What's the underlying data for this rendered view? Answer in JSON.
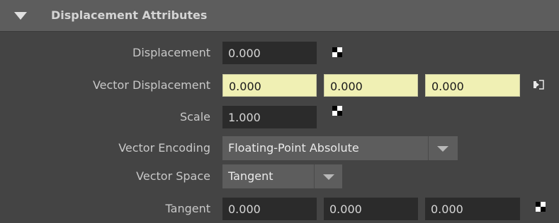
{
  "section": {
    "title": "Displacement Attributes",
    "expanded": true
  },
  "rows": {
    "displacement": {
      "label": "Displacement",
      "value": "0.000",
      "icon": "map-checker-icon"
    },
    "vector_displacement": {
      "label": "Vector Displacement",
      "values": [
        "0.000",
        "0.000",
        "0.000"
      ],
      "icon": "connection-navigate-icon",
      "connected_color": "#f0f0b4"
    },
    "scale": {
      "label": "Scale",
      "value": "1.000",
      "icon": "map-checker-icon"
    },
    "vector_encoding": {
      "label": "Vector Encoding",
      "selected": "Floating-Point Absolute"
    },
    "vector_space": {
      "label": "Vector Space",
      "selected": "Tangent"
    },
    "tangent": {
      "label": "Tangent",
      "values": [
        "0.000",
        "0.000",
        "0.000"
      ],
      "icon": "map-checker-icon"
    }
  },
  "colors": {
    "background": "#444444",
    "header": "#5d5d5d",
    "field": "#2b2b2b",
    "connected_field": "#f0f0b4"
  }
}
